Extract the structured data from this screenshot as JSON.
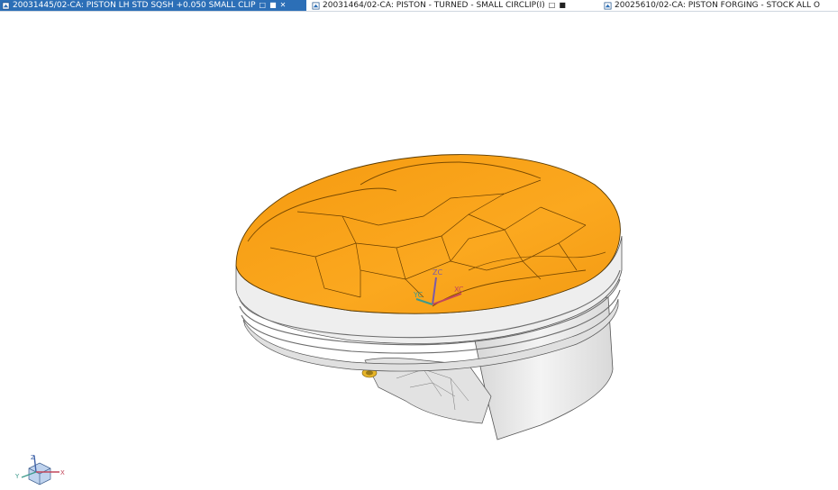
{
  "tabs": [
    {
      "label": "20031445/02-CA: PISTON LH STD SQSH +0.050 SMALL CLIP",
      "active": true,
      "status_icons": [
        "file-icon",
        "lock-icon",
        "close-icon"
      ]
    },
    {
      "label": "20031464/02-CA: PISTON - TURNED - SMALL CIRCLIP(I)",
      "active": false,
      "status_icons": [
        "file-icon",
        "lock-icon"
      ]
    },
    {
      "label": "20025610/02-CA: PISTON FORGING - STOCK ALL O",
      "active": false,
      "status_icons": []
    }
  ],
  "colors": {
    "active_tab": "#2c6fb7",
    "part_top": "#f7a21a",
    "part_body": "#e8e8e8",
    "axis_z": "#7b5aa8",
    "axis_x": "#c2465a",
    "axis_y": "#3f9a8c"
  },
  "datum_triad": {
    "z": "ZC",
    "x": "XC",
    "y": "YC"
  },
  "view_triad": {
    "z": "Z",
    "x": "X",
    "y": "Y"
  }
}
